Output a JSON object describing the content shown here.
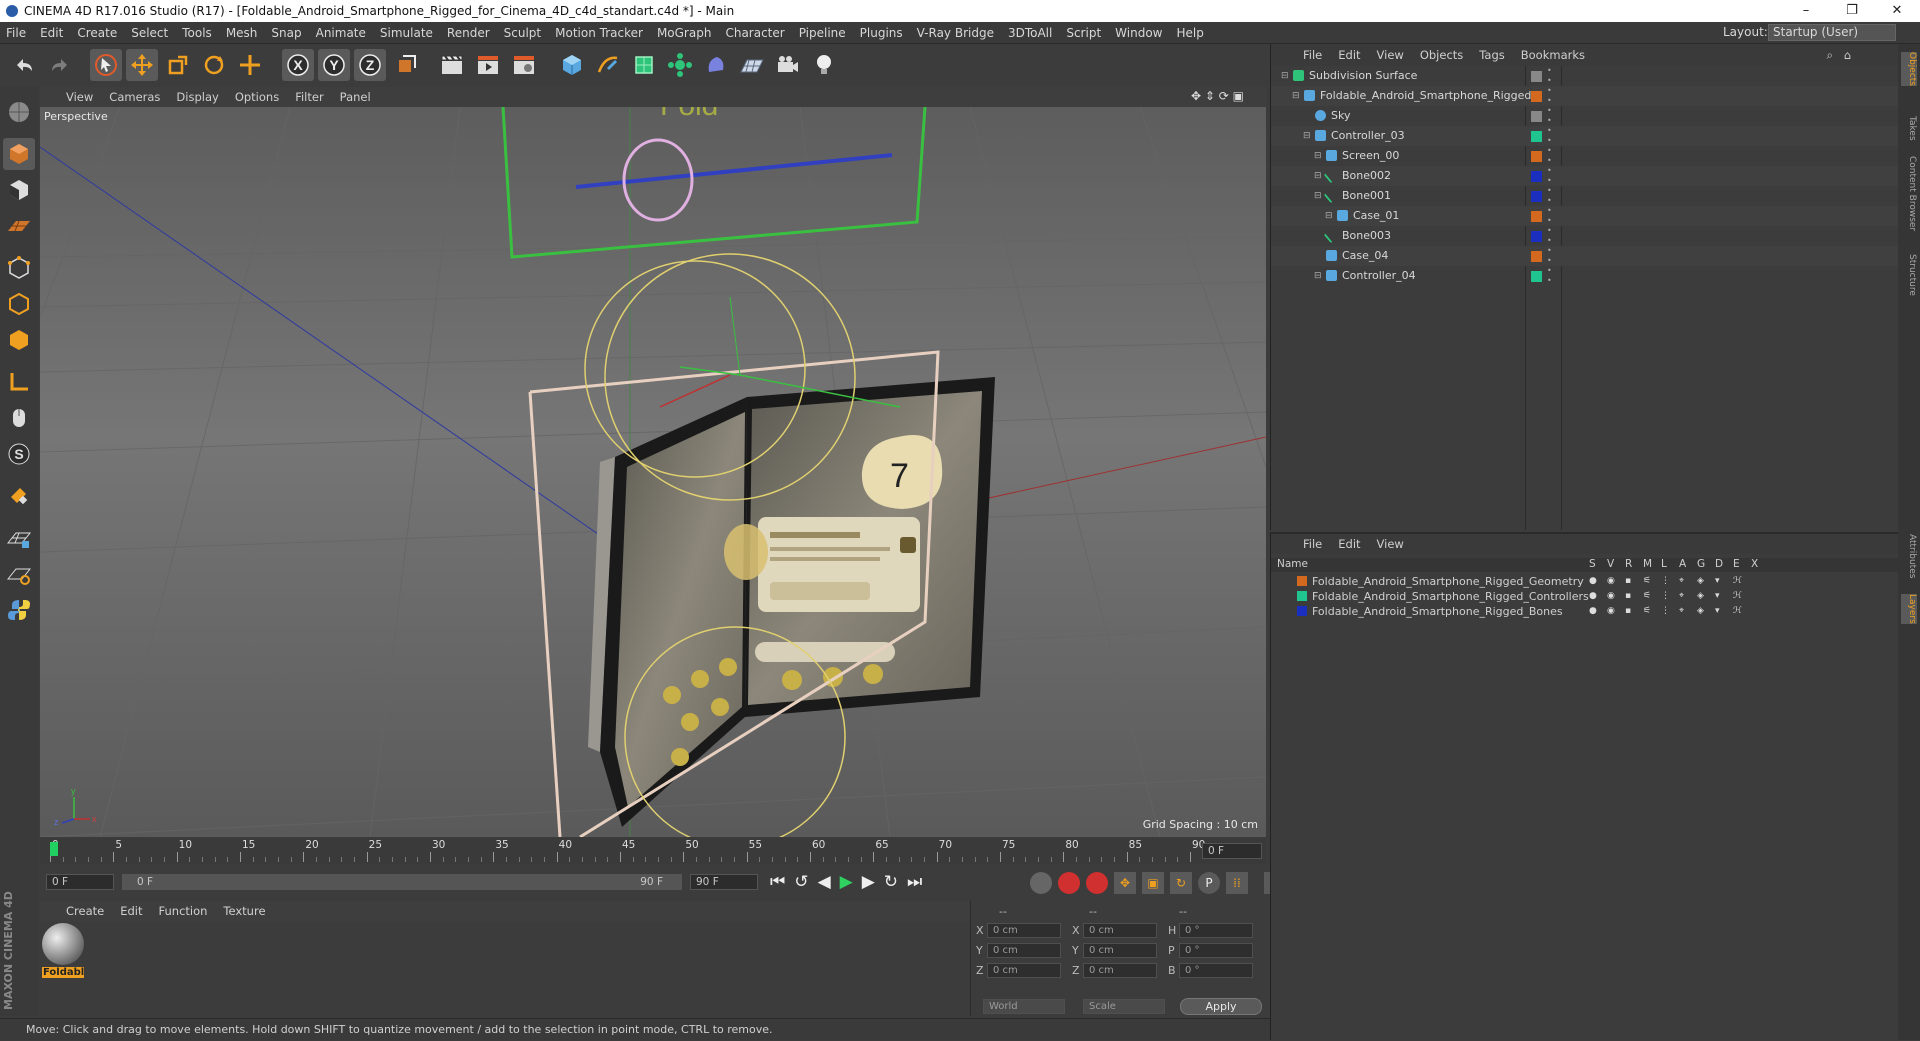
{
  "window": {
    "title": "CINEMA 4D R17.016 Studio (R17) - [Foldable_Android_Smartphone_Rigged_for_Cinema_4D_c4d_standart.c4d *] - Main",
    "minimize": "–",
    "maximize": "❐",
    "close": "✕"
  },
  "menubar": {
    "items": [
      "File",
      "Edit",
      "Create",
      "Select",
      "Tools",
      "Mesh",
      "Snap",
      "Animate",
      "Simulate",
      "Render",
      "Sculpt",
      "Motion Tracker",
      "MoGraph",
      "Character",
      "Pipeline",
      "Plugins",
      "V-Ray Bridge",
      "3DToAll",
      "Script",
      "Window",
      "Help"
    ],
    "layout_label": "Layout:",
    "layout_value": "Startup (User)"
  },
  "toolbar": {
    "axis_x": "X",
    "axis_y": "Y",
    "axis_z": "Z"
  },
  "viewport": {
    "menu": [
      "View",
      "Cameras",
      "Display",
      "Options",
      "Filter",
      "Panel"
    ],
    "camera_label": "Perspective",
    "grid_spacing": "Grid Spacing : 10 cm",
    "axis_labels": {
      "x": "x",
      "y": "y",
      "z": "z"
    }
  },
  "timeline": {
    "ticks": [
      "0",
      "5",
      "10",
      "15",
      "20",
      "25",
      "30",
      "35",
      "40",
      "45",
      "50",
      "55",
      "60",
      "65",
      "70",
      "75",
      "80",
      "85",
      "90"
    ],
    "current_frame": "0 F",
    "start_frame": "0 F",
    "range_start": "0 F",
    "range_end": "90 F",
    "end_frame": "90 F",
    "playhead_fraction": 0
  },
  "material_manager": {
    "menu": [
      "Create",
      "Edit",
      "Function",
      "Texture"
    ],
    "material_name": "Foldabl"
  },
  "coordinates": {
    "header": [
      "--",
      "--",
      "--"
    ],
    "rows": [
      {
        "a_label": "X",
        "a_value": "0 cm",
        "b_label": "X",
        "b_value": "0 cm",
        "c_label": "H",
        "c_value": "0 °"
      },
      {
        "a_label": "Y",
        "a_value": "0 cm",
        "b_label": "Y",
        "b_value": "0 cm",
        "c_label": "P",
        "c_value": "0 °"
      },
      {
        "a_label": "Z",
        "a_value": "0 cm",
        "b_label": "Z",
        "b_value": "0 cm",
        "c_label": "B",
        "c_value": "0 °"
      }
    ],
    "mode_select": "World",
    "scale_select": "Scale",
    "apply_label": "Apply"
  },
  "statusbar": {
    "text": "Move: Click and drag to move elements. Hold down SHIFT to quantize movement / add to the selection in point mode, CTRL to remove."
  },
  "branding": {
    "logo": "MAXON CINEMA 4D"
  },
  "object_manager": {
    "menu": [
      "File",
      "Edit",
      "View",
      "Objects",
      "Tags",
      "Bookmarks"
    ],
    "objects": [
      {
        "name": "Subdivision Surface",
        "indent": 0,
        "color": "#888888",
        "icon": "subdivision-icon"
      },
      {
        "name": "Foldable_Android_Smartphone_Rigged",
        "indent": 1,
        "color": "#d2691e",
        "icon": "null-icon"
      },
      {
        "name": "Sky",
        "indent": 2,
        "color": "#888888",
        "icon": "sky-icon"
      },
      {
        "name": "Controller_03",
        "indent": 2,
        "color": "#1fc48f",
        "icon": "joint-icon"
      },
      {
        "name": "Screen_00",
        "indent": 3,
        "color": "#d2691e",
        "icon": "joint-icon"
      },
      {
        "name": "Bone002",
        "indent": 3,
        "color": "#1a2fbf",
        "icon": "bone-icon"
      },
      {
        "name": "Bone001",
        "indent": 3,
        "color": "#1a2fbf",
        "icon": "bone-icon"
      },
      {
        "name": "Case_01",
        "indent": 4,
        "color": "#d2691e",
        "icon": "joint-icon"
      },
      {
        "name": "Bone003",
        "indent": 3,
        "color": "#1a2fbf",
        "icon": "bone-icon"
      },
      {
        "name": "Case_04",
        "indent": 3,
        "color": "#d2691e",
        "icon": "joint-icon"
      },
      {
        "name": "Controller_04",
        "indent": 3,
        "color": "#1fc48f",
        "icon": "joint-icon"
      }
    ]
  },
  "layer_manager": {
    "menu": [
      "File",
      "Edit",
      "View"
    ],
    "columns": [
      "Name",
      "S",
      "V",
      "R",
      "M",
      "L",
      "A",
      "G",
      "D",
      "E",
      "X"
    ],
    "layers": [
      {
        "name": "Foldable_Android_Smartphone_Rigged_Geometry",
        "color": "#d2691e"
      },
      {
        "name": "Foldable_Android_Smartphone_Rigged_Controllers",
        "color": "#1fc48f"
      },
      {
        "name": "Foldable_Android_Smartphone_Rigged_Bones",
        "color": "#1a2fbf"
      }
    ]
  },
  "side_tabs": [
    "Objects",
    "Takes",
    "Content Browser",
    "Structure",
    "Attributes",
    "Layers"
  ]
}
